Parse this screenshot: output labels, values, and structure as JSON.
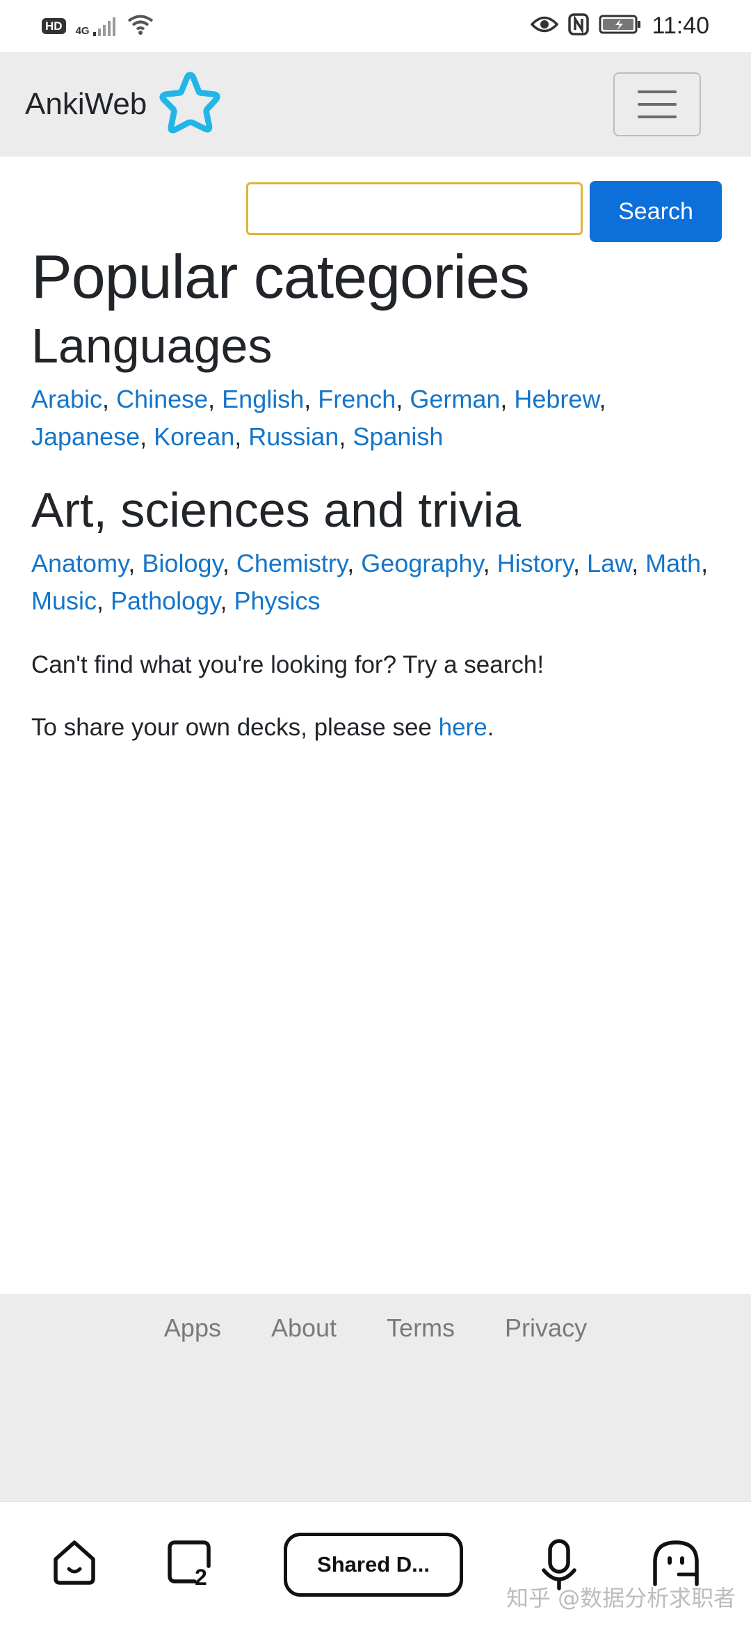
{
  "status_bar": {
    "hd_label": "HD",
    "network_label": "4G",
    "time": "11:40"
  },
  "header": {
    "brand": "AnkiWeb",
    "logo_color": "#22b5e8",
    "menu_icon": "hamburger-menu-icon"
  },
  "search": {
    "value": "",
    "placeholder": "",
    "button_label": "Search",
    "accent": "#0d6fd9"
  },
  "main": {
    "title": "Popular categories",
    "sections": [
      {
        "heading": "Languages",
        "links": [
          "Arabic",
          "Chinese",
          "English",
          "French",
          "German",
          "Hebrew",
          "Japanese",
          "Korean",
          "Russian",
          "Spanish"
        ]
      },
      {
        "heading": "Art, sciences and trivia",
        "links": [
          "Anatomy",
          "Biology",
          "Chemistry",
          "Geography",
          "History",
          "Law",
          "Math",
          "Music",
          "Pathology",
          "Physics"
        ]
      }
    ],
    "search_hint": "Can't find what you're looking for? Try a search!",
    "share_prefix": "To share your own decks, please see ",
    "share_link": "here",
    "share_suffix": ".",
    "link_color": "#1475c9"
  },
  "footer": {
    "links": [
      "Apps",
      "About",
      "Terms",
      "Privacy"
    ]
  },
  "bottom_bar": {
    "home_icon": "home-icon",
    "tabs_icon": "tabs-icon",
    "tab_count": "2",
    "current_tab": "Shared D...",
    "mic_icon": "microphone-icon",
    "assistant_icon": "assistant-icon"
  },
  "watermark": "知乎 @数据分析求职者"
}
